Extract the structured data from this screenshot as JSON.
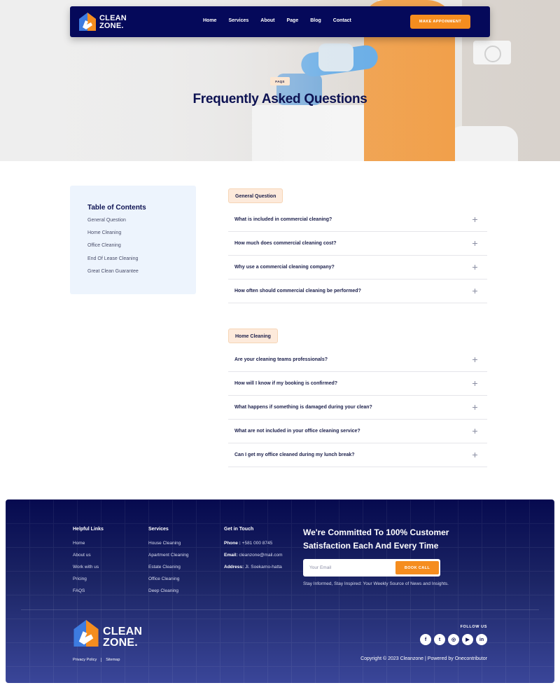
{
  "brand": {
    "name_line1": "CLEAN",
    "name_line2": "ZONE."
  },
  "nav": {
    "links": [
      "Home",
      "Services",
      "About",
      "Page",
      "Blog",
      "Contact"
    ],
    "cta": "MAKE APPOINMENT"
  },
  "hero": {
    "badge": "FAQS",
    "title": "Frequently Asked Questions"
  },
  "toc": {
    "title": "Table of Contents",
    "items": [
      "General Question",
      "Home Cleaning",
      "Office Cleaning",
      "End Of Lease Cleaning",
      "Great Clean Guarantee"
    ]
  },
  "faq_sections": [
    {
      "tag": "General Question",
      "questions": [
        "What is included in commercial cleaning?",
        "How much does commercial cleaning cost?",
        "Why use a commercial cleaning company?",
        "How often should commercial cleaning be performed?"
      ]
    },
    {
      "tag": "Home Cleaning",
      "questions": [
        "Are your cleaning teams professionals?",
        "How will I know if my booking is confirmed?",
        "What happens if something is damaged during your clean?",
        "What are not included in your office cleaning service?",
        "Can I get my office cleaned during my lunch break?"
      ]
    }
  ],
  "footer": {
    "helpful": {
      "heading": "Helpful Links",
      "links": [
        "Home",
        "About us",
        "Work with us",
        "Pricing",
        "FAQS"
      ]
    },
    "services": {
      "heading": "Services",
      "links": [
        "House Cleaning",
        "Apartment Cleaning",
        "Estate Cleaning",
        "Office Cleaning",
        "Deep Cleaning"
      ]
    },
    "contact": {
      "heading": "Get in Touch",
      "phone_label": "Phone :",
      "phone": "+581 000 8745",
      "email_label": "Email:",
      "email": "cleanzone@mail.com",
      "address_label": "Address:",
      "address": "Jl. Soekarno-hatta"
    },
    "tagline": "We're Committed To 100% Customer Satisfaction Each And Every Time",
    "subscribe": {
      "placeholder": "Your Email",
      "button": "BOOK CALL"
    },
    "note": "Stay Informed, Stay Inspired: Your Weekly Source of News and Insights.",
    "legal": [
      "Privacy Policy",
      "Sitemap"
    ],
    "follow": "FOLLOW US",
    "socials": [
      {
        "icon": "facebook-icon",
        "glyph": "f"
      },
      {
        "icon": "twitter-icon",
        "glyph": "t"
      },
      {
        "icon": "instagram-icon",
        "glyph": "◎"
      },
      {
        "icon": "youtube-icon",
        "glyph": "▶"
      },
      {
        "icon": "linkedin-icon",
        "glyph": "in"
      }
    ],
    "copyright": "Copyright © 2023 Cleanzone | Powered by Onecontributor"
  },
  "colors": {
    "navy": "#05095a",
    "accent": "#f58d1f",
    "toc_bg": "#edf4fd",
    "tag_bg": "#fdeadb"
  }
}
